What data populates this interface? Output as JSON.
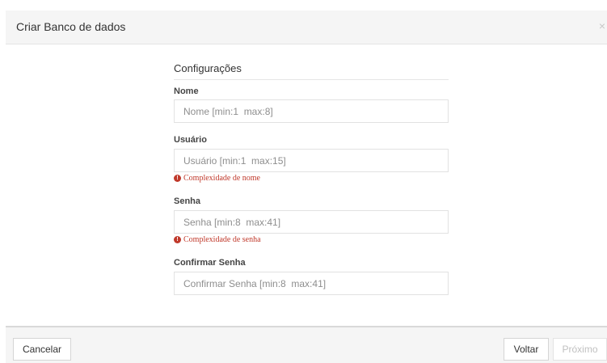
{
  "modal": {
    "title": "Criar Banco de dados",
    "close_label": "×"
  },
  "section": {
    "title": "Configurações"
  },
  "fields": {
    "nome": {
      "label": "Nome",
      "value": "",
      "placeholder": "Nome [min:1  max:8]"
    },
    "usuario": {
      "label": "Usuário",
      "value": "",
      "placeholder": "Usuário [min:1  max:15]",
      "error": "Complexidade de nome"
    },
    "senha": {
      "label": "Senha",
      "value": "",
      "placeholder": "Senha [min:8  max:41]",
      "error": "Complexidade de senha"
    },
    "confirmar": {
      "label": "Confirmar Senha",
      "value": "",
      "placeholder": "Confirmar Senha [min:8  max:41]"
    }
  },
  "error_icon_glyph": "!",
  "footer": {
    "cancel_label": "Cancelar",
    "back_label": "Voltar",
    "next_label": "Próximo"
  },
  "colors": {
    "error": "#c0392b",
    "header_bg": "#f5f5f5",
    "disabled_text": "#c0c0c0"
  },
  "icons": {
    "close": "close-icon",
    "error": "exclamation-circle-icon"
  }
}
